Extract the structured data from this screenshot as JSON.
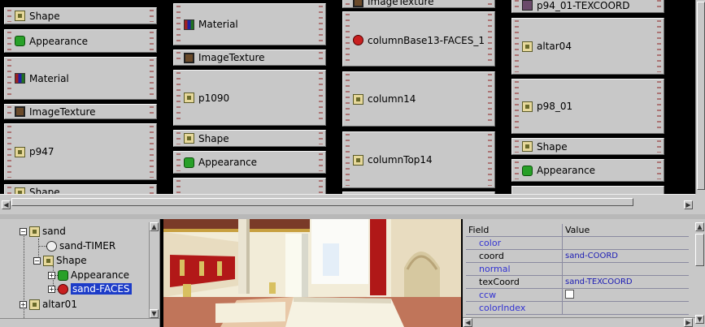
{
  "graph": {
    "nodes": [
      {
        "id": "n1",
        "label": "Shape",
        "icon": "shape-icon"
      },
      {
        "id": "n2",
        "label": "Appearance",
        "icon": "appearance-icon"
      },
      {
        "id": "n3",
        "label": "Material",
        "icon": "material-icon"
      },
      {
        "id": "n4",
        "label": "ImageTexture",
        "icon": "texture-icon"
      },
      {
        "id": "n5",
        "label": "p947",
        "icon": "transform-icon"
      },
      {
        "id": "n6",
        "label": "Shape",
        "icon": "shape-icon"
      },
      {
        "id": "n7",
        "label": "Material",
        "icon": "material-icon"
      },
      {
        "id": "n8",
        "label": "ImageTexture",
        "icon": "texture-icon"
      },
      {
        "id": "n9",
        "label": "p1090",
        "icon": "transform-icon"
      },
      {
        "id": "n10",
        "label": "Shape",
        "icon": "shape-icon"
      },
      {
        "id": "n11",
        "label": "Appearance",
        "icon": "appearance-icon"
      },
      {
        "id": "n12",
        "label": "ImageTexture",
        "icon": "texture-icon"
      },
      {
        "id": "n13",
        "label": "columnBase13-FACES_1",
        "icon": "faces-icon"
      },
      {
        "id": "n14",
        "label": "column14",
        "icon": "transform-icon"
      },
      {
        "id": "n15",
        "label": "columnTop14",
        "icon": "transform-icon"
      },
      {
        "id": "n16",
        "label": "p94_01-TEXCOORD",
        "icon": "coord-icon"
      },
      {
        "id": "n17",
        "label": "altar04",
        "icon": "transform-icon"
      },
      {
        "id": "n18",
        "label": "p98_01",
        "icon": "transform-icon"
      },
      {
        "id": "n19",
        "label": "Shape",
        "icon": "shape-icon"
      },
      {
        "id": "n20",
        "label": "Appearance",
        "icon": "appearance-icon"
      }
    ]
  },
  "tree": {
    "items": [
      {
        "label": "sand",
        "icon": "shape-icon",
        "expander": "−"
      },
      {
        "label": "sand-TIMER",
        "icon": "clock-icon",
        "expander": ""
      },
      {
        "label": "Shape",
        "icon": "shape-icon",
        "expander": "−"
      },
      {
        "label": "Appearance",
        "icon": "appearance-icon",
        "expander": "+"
      },
      {
        "label": "sand-FACES",
        "icon": "faces-icon",
        "expander": "+"
      },
      {
        "label": "altar01",
        "icon": "shape-icon",
        "expander": "+"
      }
    ]
  },
  "props": {
    "header_field": "Field",
    "header_value": "Value",
    "rows": [
      {
        "field": "color",
        "value": ""
      },
      {
        "field": "coord",
        "value": "sand-COORD"
      },
      {
        "field": "normal",
        "value": ""
      },
      {
        "field": "texCoord",
        "value": "sand-TEXCOORD"
      },
      {
        "field": "ccw",
        "value": ""
      },
      {
        "field": "colorIndex",
        "value": ""
      }
    ]
  },
  "colors": {
    "selection": "#1c3cc8",
    "panel": "#c8c8c8",
    "link": "#3232d2"
  }
}
